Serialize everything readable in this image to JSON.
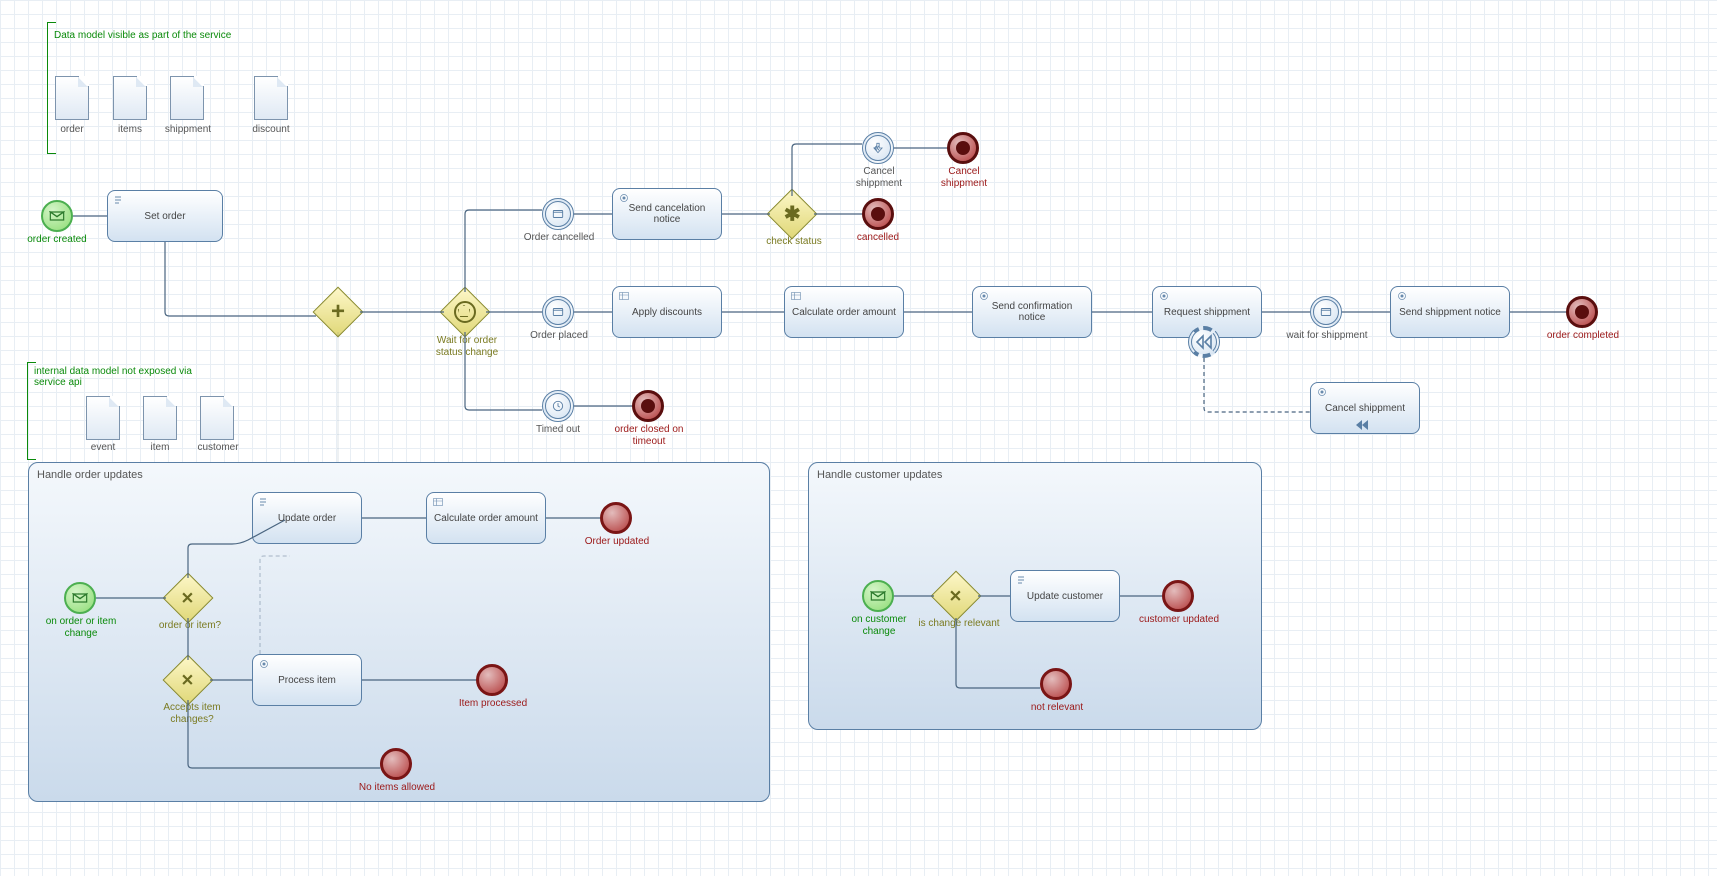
{
  "annotations": {
    "visible_model": "Data model visible as part of the service",
    "internal_model": "internal data model not exposed via service api"
  },
  "data_objects": {
    "order": "order",
    "items": "items",
    "shippment": "shippment",
    "discount": "discount",
    "event": "event",
    "item": "item",
    "customer": "customer"
  },
  "events": {
    "order_created": "order created",
    "order_cancelled": "Order cancelled",
    "order_placed": "Order placed",
    "timed_out": "Timed out",
    "cancel_shippment_evt": "Cancel shippment",
    "wait_for_shippment": "wait for shippment",
    "on_order_item_change": "on order or item change",
    "on_customer_change": "on customer change"
  },
  "tasks": {
    "set_order": "Set order",
    "send_cancel_notice": "Send cancelation notice",
    "apply_discounts": "Apply discounts",
    "calc_order_amount": "Calculate order amount",
    "send_confirm_notice": "Send confirmation notice",
    "request_shippment": "Request shippment",
    "send_shippment_notice": "Send shippment notice",
    "cancel_shippment_task": "Cancel shippment",
    "update_order": "Update order",
    "calc_order_amount2": "Calculate order amount",
    "process_item": "Process item",
    "update_customer": "Update customer"
  },
  "gateways": {
    "parallel": "",
    "wait_status": "Wait for order status change",
    "check_status": "check status",
    "order_or_item": "order or item?",
    "accepts_item": "Accepts item changes?",
    "is_change_relevant": "is change relevant"
  },
  "ends": {
    "cancel_shippment": "Cancel shippment",
    "cancelled": "cancelled",
    "closed_timeout": "order closed on timeout",
    "order_completed": "order completed",
    "order_updated": "Order updated",
    "item_processed": "Item processed",
    "no_items_allowed": "No items allowed",
    "customer_updated": "customer updated",
    "not_relevant": "not relevant"
  },
  "subprocesses": {
    "handle_order": "Handle order updates",
    "handle_customer": "Handle customer updates"
  }
}
